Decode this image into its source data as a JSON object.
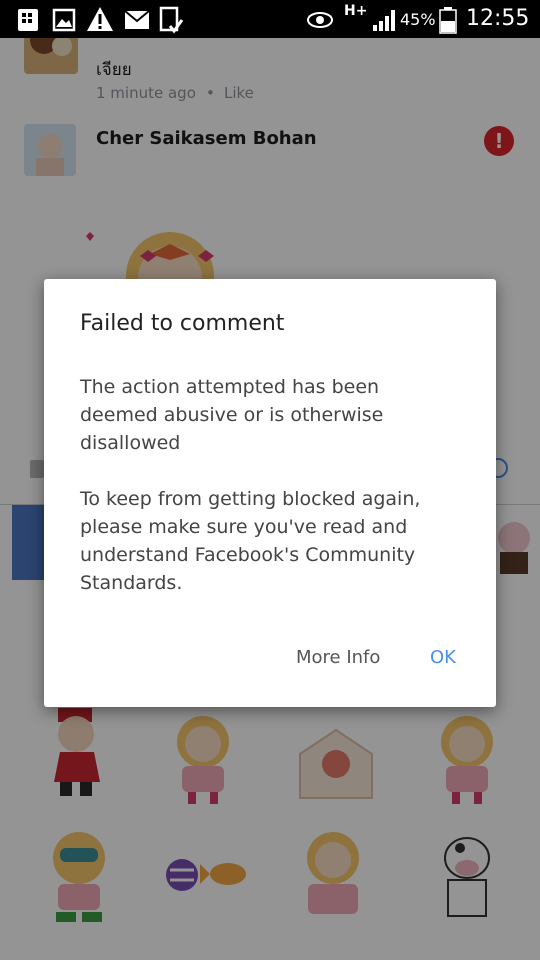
{
  "status_bar": {
    "battery_percent": "45%",
    "time": "12:55",
    "network": "H+",
    "icons": [
      "bbm-notification-icon",
      "image-icon",
      "warning-icon",
      "mail-icon",
      "download-done-icon",
      "eye-icon",
      "signal-icon",
      "battery-icon"
    ]
  },
  "comments": [
    {
      "text": "เจียย",
      "meta_time": "1 minute ago",
      "meta_sep": "•",
      "like_label": "Like"
    },
    {
      "name": "Cher Saikasem Bohan",
      "alert_symbol": "!"
    }
  ],
  "dialog": {
    "title": "Failed to comment",
    "message": "The action attempted has been deemed abusive or is otherwise disallowed",
    "advice": "To keep from getting blocked again, please make sure you've read and understand Facebook's Community Standards.",
    "more_info_label": "More Info",
    "ok_label": "OK"
  },
  "colors": {
    "accent": "#4a90e2",
    "alert": "#d9262c",
    "button_neutral": "#555555"
  }
}
